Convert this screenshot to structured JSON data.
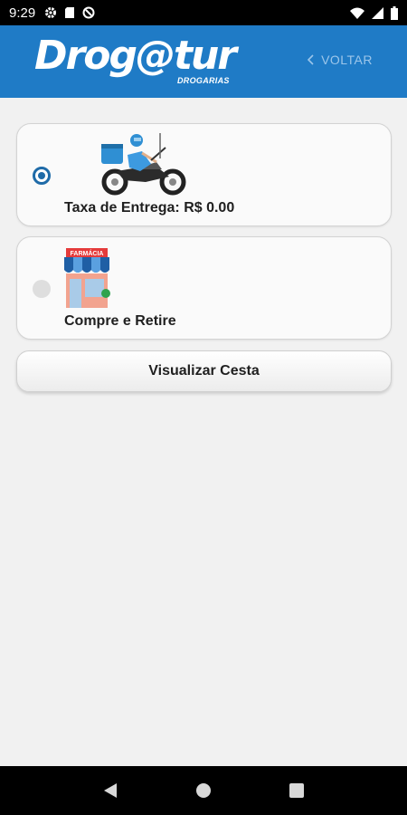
{
  "status_bar": {
    "time": "9:29"
  },
  "header": {
    "logo": "Drog@tur",
    "logo_subtitle": "DROGARIAS",
    "back_label": "VOLTAR",
    "color": "#1f7bc6"
  },
  "options": [
    {
      "label": "Taxa de Entrega: R$ 0.00",
      "selected": true,
      "icon": "delivery-motorbike-icon"
    },
    {
      "label": "Compre e Retire",
      "selected": false,
      "icon": "pharmacy-store-icon",
      "store_sign": "FARMÁCIA"
    }
  ],
  "view_basket_label": "Visualizar Cesta"
}
